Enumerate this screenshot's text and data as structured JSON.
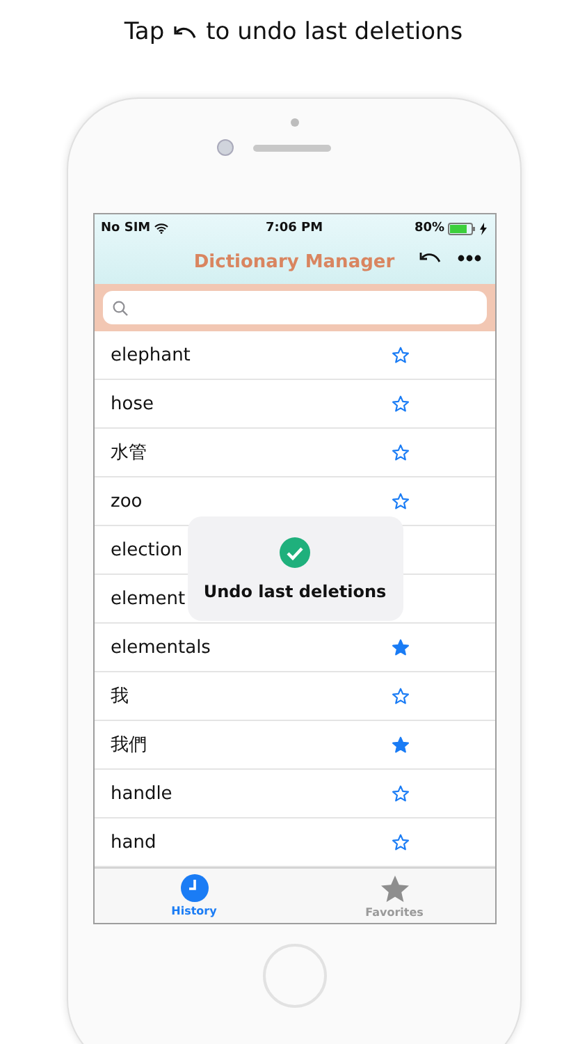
{
  "caption": {
    "before": "Tap",
    "after": "to undo last deletions"
  },
  "status_bar": {
    "carrier": "No SIM",
    "time": "7:06 PM",
    "battery": "80%"
  },
  "nav": {
    "title": "Dictionary Manager"
  },
  "words": [
    {
      "text": "elephant",
      "favorite": false
    },
    {
      "text": "hose",
      "favorite": false
    },
    {
      "text": "水管",
      "favorite": false
    },
    {
      "text": "zoo",
      "favorite": false
    },
    {
      "text": "election"
    },
    {
      "text": "element"
    },
    {
      "text": "elementals",
      "favorite": true
    },
    {
      "text": "我",
      "favorite": false
    },
    {
      "text": "我們",
      "favorite": true
    },
    {
      "text": "handle",
      "favorite": false
    },
    {
      "text": "hand",
      "favorite": false
    }
  ],
  "toast": {
    "message": "Undo last deletions"
  },
  "tabs": [
    {
      "label": "History",
      "kind": "clock",
      "selected": true
    },
    {
      "label": "Favorites",
      "kind": "star",
      "selected": false
    }
  ]
}
